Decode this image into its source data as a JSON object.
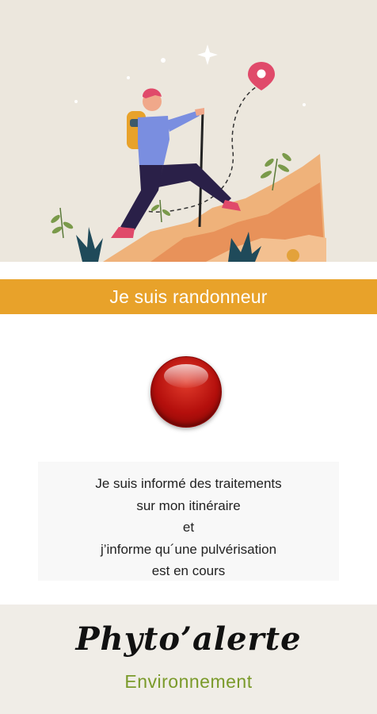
{
  "role_banner": {
    "label": "Je suis randonneur"
  },
  "info_text": {
    "line1": "Je suis informé des traitements",
    "line2": "sur mon itinéraire",
    "line3": "et",
    "line4": "j’informe qu´une pulvérisation",
    "line5": "est en cours"
  },
  "brand": {
    "title": "Phyto’alerte",
    "subtitle": "Environnement"
  },
  "colors": {
    "banner": "#e8a22a",
    "alert_button": "#c0140f",
    "subtitle": "#7a9a2a",
    "hero_background": "#ece7dd"
  },
  "icons": {
    "hero": "hiker-illustration",
    "pin": "location-pin-icon",
    "alert": "red-round-button"
  }
}
